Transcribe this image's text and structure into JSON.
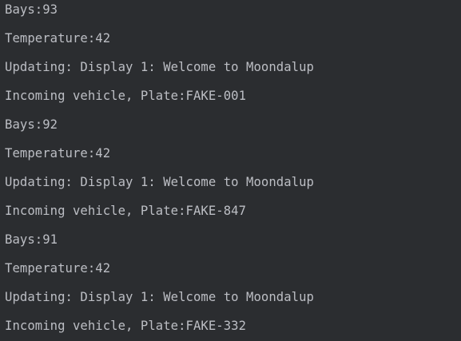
{
  "console": {
    "lines": [
      "Bays:93",
      "Temperature:42",
      "Updating: Display 1: Welcome to Moondalup",
      "Incoming vehicle, Plate:FAKE-001",
      "Bays:92",
      "Temperature:42",
      "Updating: Display 1: Welcome to Moondalup",
      "Incoming vehicle, Plate:FAKE-847",
      "Bays:91",
      "Temperature:42",
      "Updating: Display 1: Welcome to Moondalup",
      "Incoming vehicle, Plate:FAKE-332"
    ]
  },
  "colors": {
    "background": "#2b2d30",
    "text": "#bcbec4"
  }
}
